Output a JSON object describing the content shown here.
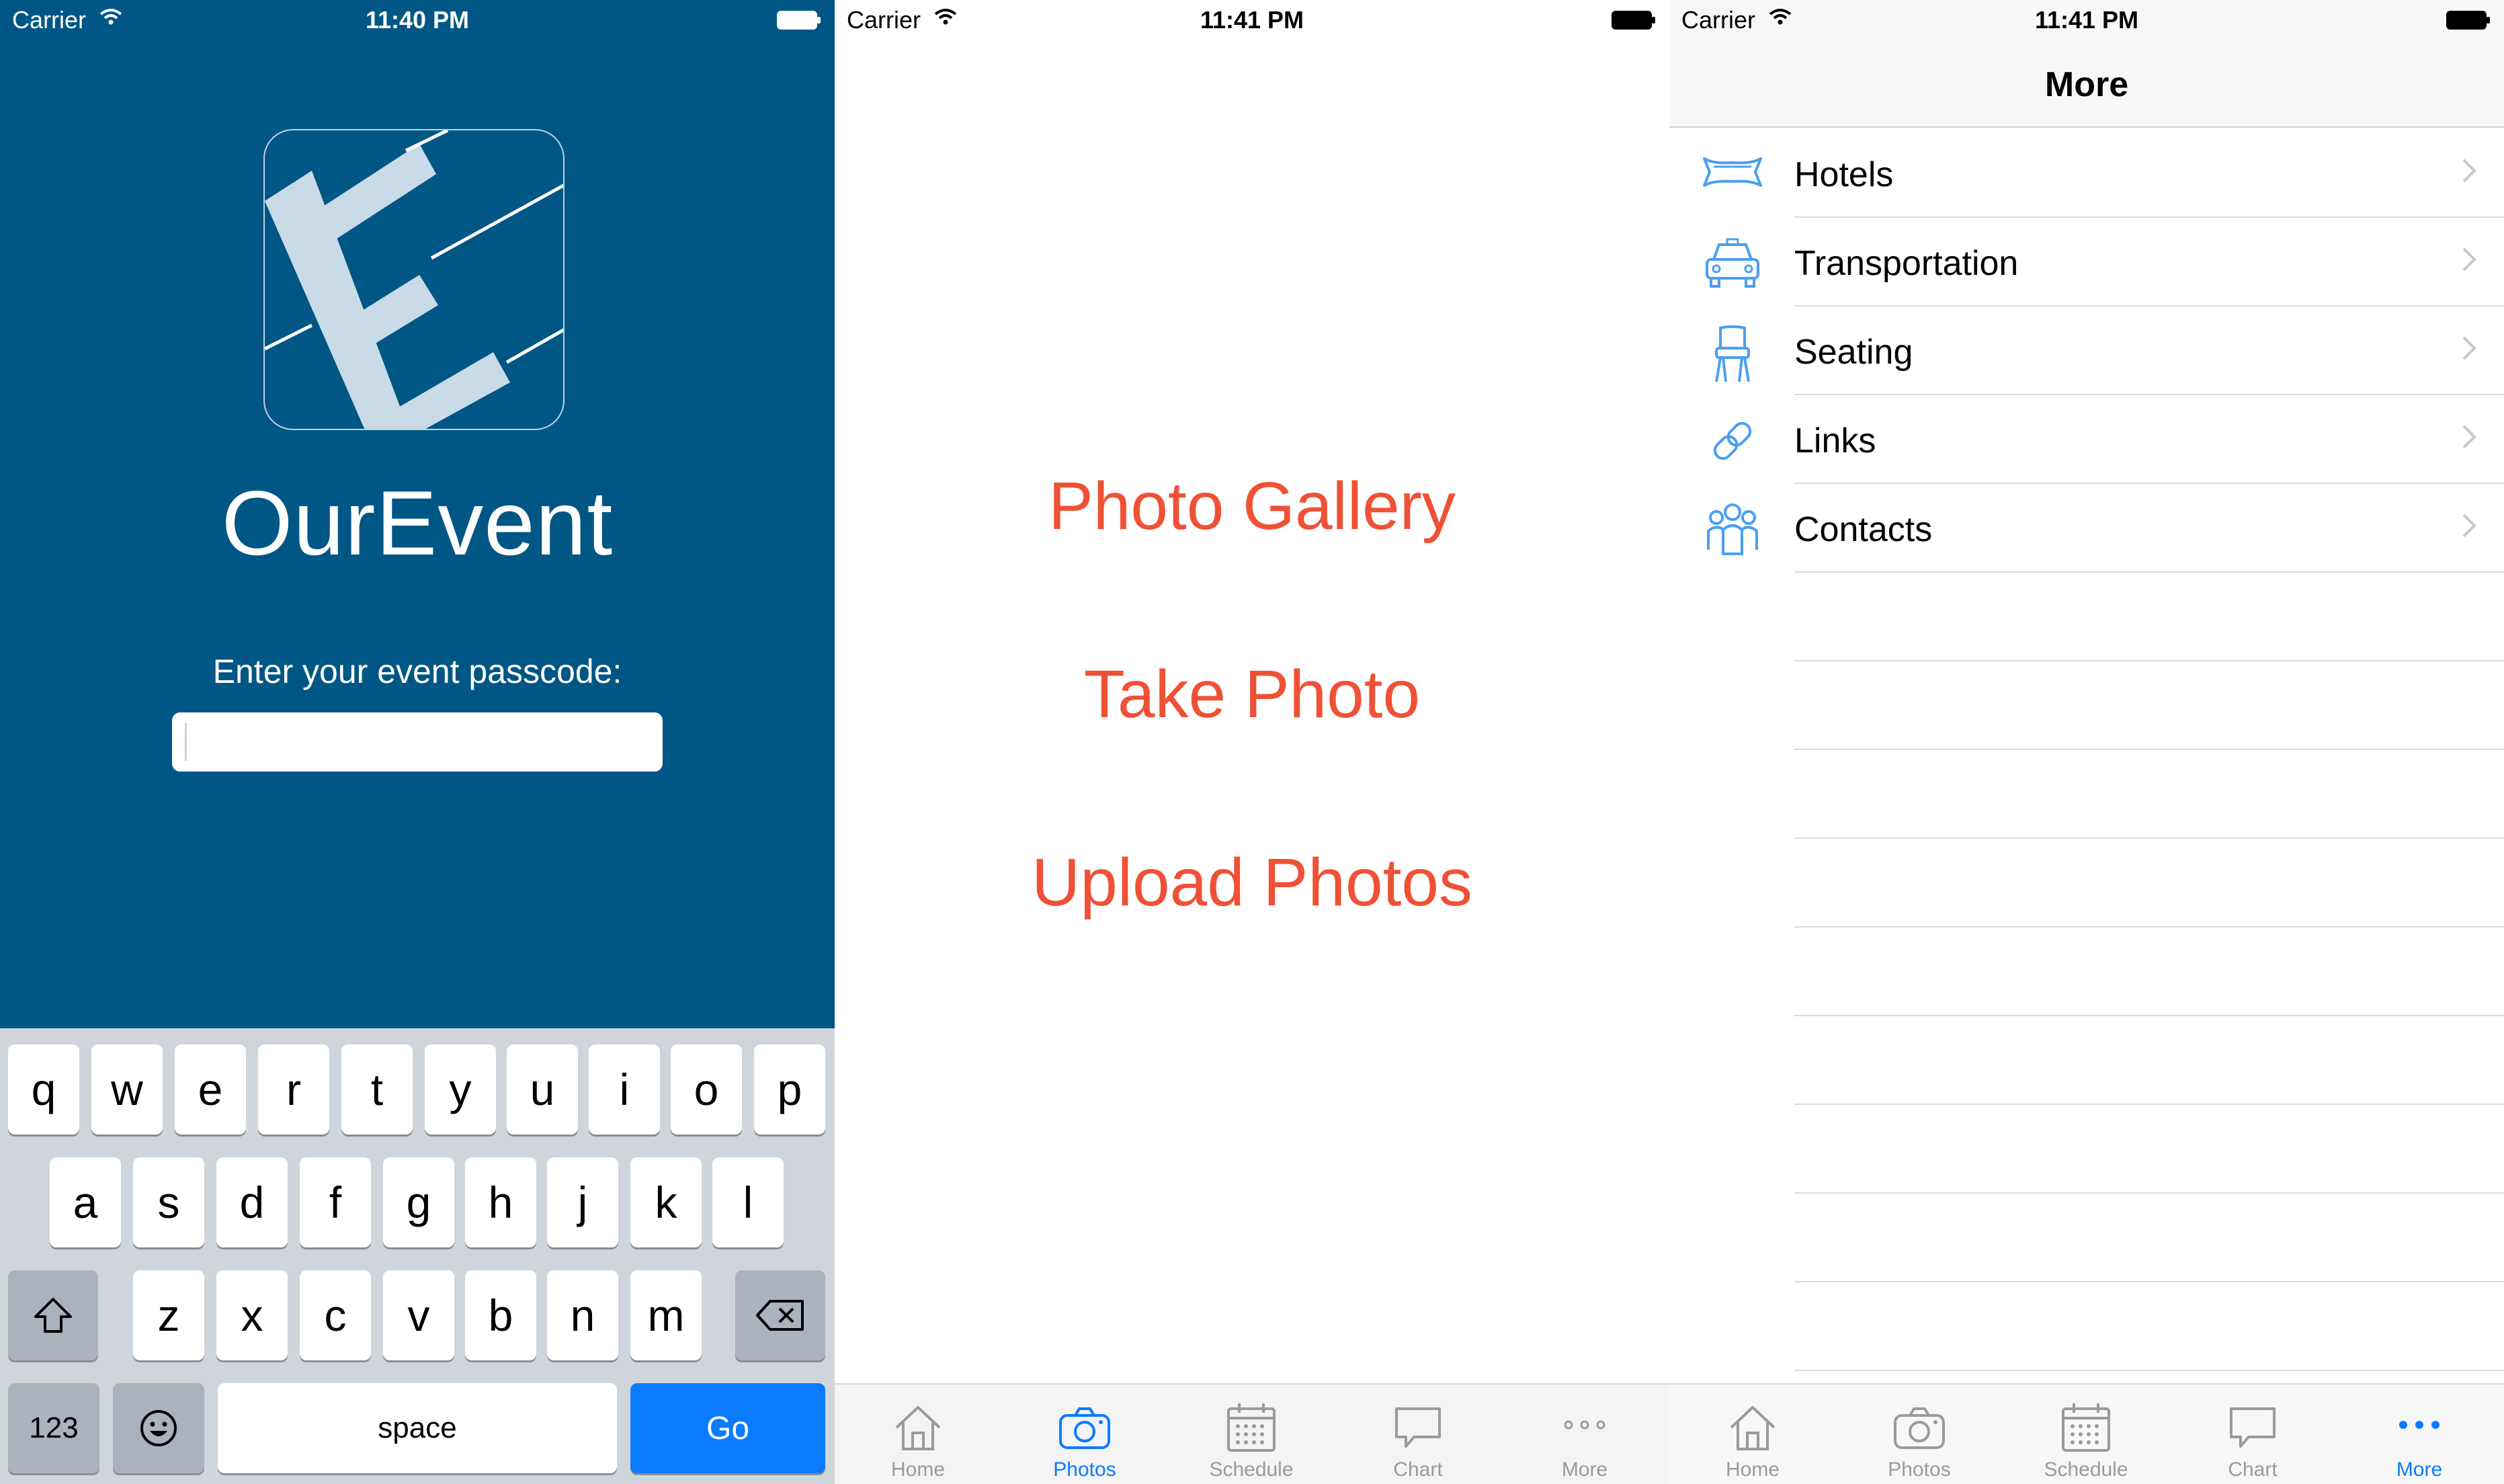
{
  "screens": {
    "login": {
      "status": {
        "carrier": "Carrier",
        "time": "11:40 PM"
      },
      "app_name": "OurEvent",
      "passcode_label": "Enter your event passcode:",
      "passcode_value": "",
      "keyboard": {
        "row1": [
          "q",
          "w",
          "e",
          "r",
          "t",
          "y",
          "u",
          "i",
          "o",
          "p"
        ],
        "row2": [
          "a",
          "s",
          "d",
          "f",
          "g",
          "h",
          "j",
          "k",
          "l"
        ],
        "row3": [
          "z",
          "x",
          "c",
          "v",
          "b",
          "n",
          "m"
        ],
        "numbers_label": "123",
        "space_label": "space",
        "go_label": "Go"
      }
    },
    "photos": {
      "status": {
        "carrier": "Carrier",
        "time": "11:41 PM"
      },
      "links": [
        "Photo Gallery",
        "Take Photo",
        "Upload Photos"
      ],
      "link_color": "#ef5136",
      "tabs": [
        {
          "label": "Home",
          "icon": "home-icon"
        },
        {
          "label": "Photos",
          "icon": "camera-icon",
          "active": true
        },
        {
          "label": "Schedule",
          "icon": "calendar-icon"
        },
        {
          "label": "Chart",
          "icon": "chat-icon"
        },
        {
          "label": "More",
          "icon": "more-icon"
        }
      ]
    },
    "more": {
      "status": {
        "carrier": "Carrier",
        "time": "11:41 PM"
      },
      "title": "More",
      "items": [
        {
          "label": "Hotels",
          "icon": "bed-icon"
        },
        {
          "label": "Transportation",
          "icon": "car-icon"
        },
        {
          "label": "Seating",
          "icon": "chair-icon"
        },
        {
          "label": "Links",
          "icon": "link-icon"
        },
        {
          "label": "Contacts",
          "icon": "people-icon"
        }
      ],
      "tabs": [
        {
          "label": "Home",
          "icon": "home-icon"
        },
        {
          "label": "Photos",
          "icon": "camera-icon"
        },
        {
          "label": "Schedule",
          "icon": "calendar-icon"
        },
        {
          "label": "Chart",
          "icon": "chat-icon"
        },
        {
          "label": "More",
          "icon": "more-icon",
          "active": true
        }
      ]
    }
  },
  "colors": {
    "login_bg": "#005684",
    "accent": "#0a7bff",
    "icon_blue": "#4a9ff0",
    "link": "#ef5136"
  }
}
